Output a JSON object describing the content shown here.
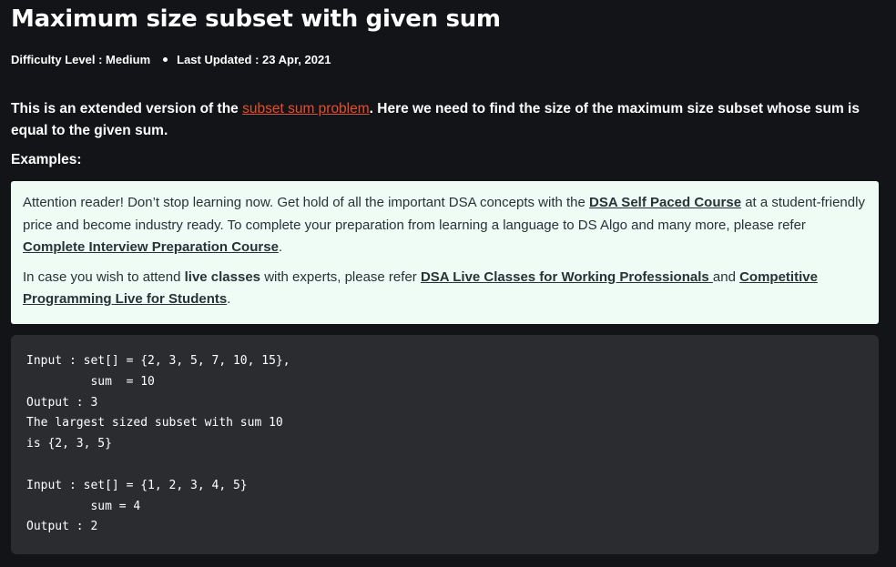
{
  "article": {
    "title": "Maximum size subset with given sum",
    "difficulty": "Difficulty Level : Medium",
    "last_updated": "Last Updated : 23 Apr, 2021",
    "intro_before_link": "This is an extended version of the ",
    "intro_link": "subset sum problem",
    "intro_after_link": ". Here we need to find the size of the maximum size subset whose sum is equal to the given sum.",
    "examples_heading": "Examples:"
  },
  "notice": {
    "p1_text1": "Attention reader! Don’t stop learning now. Get hold of all the important DSA concepts with the ",
    "p1_link1": "DSA Self Paced Course",
    "p1_text2": " at a student-friendly price and become industry ready.  To complete your preparation from learning a language to DS Algo and many more,  please refer ",
    "p1_link2": "Complete Interview Preparation Course",
    "p1_text3": ".",
    "p2_text1": "In case you wish to attend ",
    "p2_bold": "live classes",
    "p2_text2": " with experts, please refer ",
    "p2_link1": "DSA Live Classes for Working Professionals ",
    "p2_text3": "and ",
    "p2_link2": "Competitive Programming Live for Students",
    "p2_text4": "."
  },
  "code": {
    "lines": [
      "Input : set[] = {2, 3, 5, 7, 10, 15},",
      "         sum  = 10",
      "Output : 3",
      "The largest sized subset with sum 10",
      "is {2, 3, 5}",
      "",
      "Input : set[] = {1, 2, 3, 4, 5}",
      "         sum = 4",
      "Output : 2"
    ]
  },
  "colors": {
    "page_background": "#131417",
    "link_accent": "#e34f2b",
    "notice_background": "#effbf5",
    "notice_text": "#273239",
    "code_background": "#2a2c30"
  }
}
